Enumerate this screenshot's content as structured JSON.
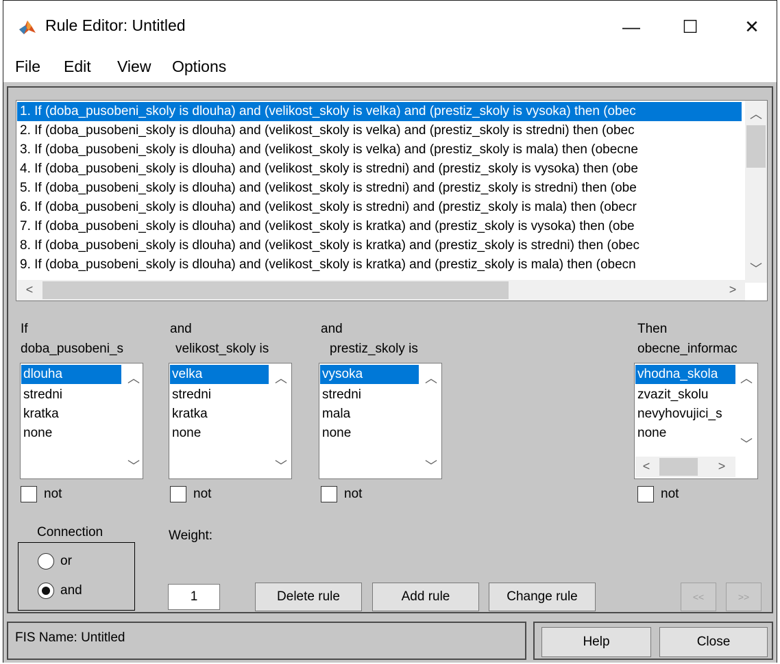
{
  "window": {
    "title": "Rule Editor: Untitled",
    "controls": {
      "minimize": "—",
      "maximize": "☐",
      "close": "✕"
    }
  },
  "menu": [
    "File",
    "Edit",
    "View",
    "Options"
  ],
  "rules": [
    "1. If (doba_pusobeni_skoly is dlouha) and (velikost_skoly is velka) and (prestiz_skoly is vysoka) then (obec",
    "2. If (doba_pusobeni_skoly is dlouha) and (velikost_skoly is velka) and (prestiz_skoly is stredni) then (obec",
    "3. If (doba_pusobeni_skoly is dlouha) and (velikost_skoly is velka) and (prestiz_skoly is mala) then (obecne",
    "4. If (doba_pusobeni_skoly is dlouha) and (velikost_skoly is stredni) and (prestiz_skoly is vysoka) then (obe",
    "5. If (doba_pusobeni_skoly is dlouha) and (velikost_skoly is stredni) and (prestiz_skoly is stredni) then (obe",
    "6. If (doba_pusobeni_skoly is dlouha) and (velikost_skoly is stredni) and (prestiz_skoly is mala) then (obecr",
    "7. If (doba_pusobeni_skoly is dlouha) and (velikost_skoly is kratka) and (prestiz_skoly is vysoka) then (obe",
    "8. If (doba_pusobeni_skoly is dlouha) and (velikost_skoly is kratka) and (prestiz_skoly is stredni) then (obec",
    "9. If (doba_pusobeni_skoly is dlouha) and (velikost_skoly is kratka) and (prestiz_skoly is mala) then (obecn"
  ],
  "inputs": [
    {
      "prefix": "If",
      "name": "doba_pusobeni_s",
      "options": [
        "dlouha",
        "stredni",
        "kratka",
        "none"
      ],
      "selected": 0,
      "not_label": "not"
    },
    {
      "prefix": "and",
      "name": "velikost_skoly is",
      "options": [
        "velka",
        "stredni",
        "kratka",
        "none"
      ],
      "selected": 0,
      "not_label": "not"
    },
    {
      "prefix": "and",
      "name": "prestiz_skoly is",
      "options": [
        "vysoka",
        "stredni",
        "mala",
        "none"
      ],
      "selected": 0,
      "not_label": "not"
    }
  ],
  "output": {
    "prefix": "Then",
    "name": "obecne_informac",
    "options": [
      "vhodna_skola",
      "zvazit_skolu",
      "nevyhovujici_s",
      "none"
    ],
    "selected": 0,
    "not_label": "not"
  },
  "connection": {
    "title": "Connection",
    "options": [
      "or",
      "and"
    ],
    "selected": "and"
  },
  "weight": {
    "label": "Weight:",
    "value": "1"
  },
  "buttons": {
    "delete": "Delete rule",
    "add": "Add rule",
    "change": "Change rule",
    "prev": "<<",
    "next": ">>"
  },
  "status": "FIS Name: Untitled",
  "footer": {
    "help": "Help",
    "close": "Close"
  },
  "colors": {
    "selection": "#0078d7",
    "panel": "#c6c6c6"
  }
}
